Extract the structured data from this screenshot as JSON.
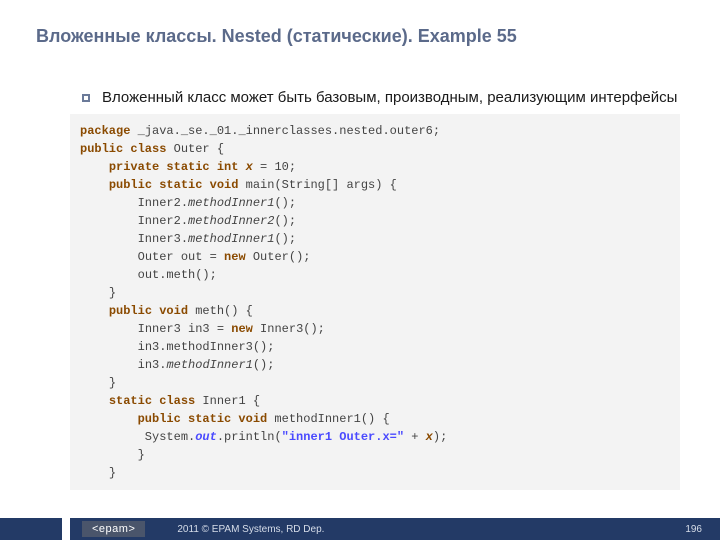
{
  "slide": {
    "title": "Вложенные классы. Nested (статические). Example 55",
    "bullet": "Вложенный класс может быть базовым, производным, реализующим интерфейсы"
  },
  "code": {
    "pkg_kw": "package",
    "pkg_name": " _java._se._01._innerclasses.nested.outer6;",
    "pub_class": "public class",
    "class_name": " Outer {",
    "priv_static_int": "private static int",
    "x_ident": "x",
    "eq10": " = 10;",
    "psv": "public static void",
    "main_sig": " main(String[] args) {",
    "m1": "methodInner1",
    "m2": "methodInner2",
    "paren": "();",
    "outer_out_a": " Outer out = ",
    "new": "new",
    "outer_out_b": " Outer();",
    "out_meth": " out.meth();",
    "closeb": "}",
    "pubvoid": "public void",
    "meth_sig": " meth() {",
    "in3a": " Inner3 in3 = ",
    "in3b": " Inner3();",
    "in3_m3": " in3.methodInner3();",
    "in3_dot": " in3.",
    "semi": ";",
    "static_class": "static class",
    "inner1_decl": " Inner1 {",
    "mi1_decl": " methodInner1() {",
    "sys": " System.",
    "out": "out",
    "println_a": ".println(",
    "str": "\"inner1 Outer.x=\"",
    "plus": " + ",
    "closep": ");",
    "ind1": "    ",
    "ind2": "        ",
    "ind3": "            ",
    "pre_i2": "Inner2.",
    "pre_i3": "Inner3.",
    "sp7": "       "
  },
  "footer": {
    "logo": "<epam>",
    "text": "2011 © EPAM Systems, RD Dep.",
    "page": "196"
  }
}
